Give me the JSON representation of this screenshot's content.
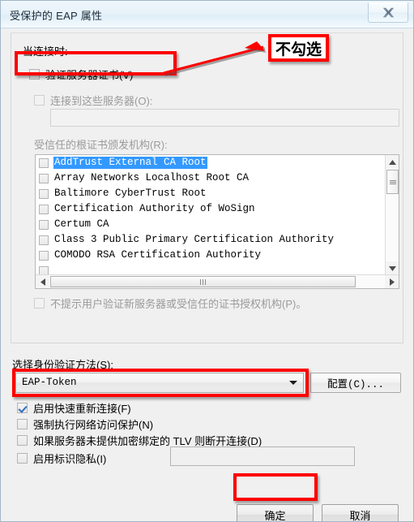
{
  "window": {
    "title": "受保护的 EAP 属性",
    "close_icon": "close-x-icon"
  },
  "group": {
    "when_connecting_label": "当连接时:",
    "validate_server_cert": {
      "label": "验证服务器证书(V)",
      "checked": false
    },
    "connect_to_servers": {
      "label": "连接到这些服务器(O):",
      "checked": false,
      "value": "",
      "disabled": true
    },
    "trusted_roots_label": "受信任的根证书颁发机构(R):",
    "certificates": [
      {
        "name": "AddTrust External CA Root",
        "checked": false,
        "selected": true
      },
      {
        "name": "Array Networks Localhost Root CA",
        "checked": false,
        "selected": false
      },
      {
        "name": "Baltimore CyberTrust Root",
        "checked": false,
        "selected": false
      },
      {
        "name": "Certification Authority of WoSign",
        "checked": false,
        "selected": false
      },
      {
        "name": "Certum CA",
        "checked": false,
        "selected": false
      },
      {
        "name": "Class 3 Public Primary Certification Authority",
        "checked": false,
        "selected": false
      },
      {
        "name": "COMODO RSA Certification Authority",
        "checked": false,
        "selected": false
      },
      {
        "name": "",
        "checked": false,
        "selected": false
      }
    ],
    "no_prompt_user": {
      "label": "不提示用户验证新服务器或受信任的证书授权机构(P)。",
      "checked": false,
      "disabled": true
    }
  },
  "auth": {
    "select_method_label": "选择身份验证方法(S):",
    "method_value": "EAP-Token",
    "configure_button": "配置(C)...",
    "dropdown_icon": "chevron-down-icon"
  },
  "options": [
    {
      "label": "启用快速重新连接(F)",
      "checked": true
    },
    {
      "label": "强制执行网络访问保护(N)",
      "checked": false
    },
    {
      "label": "如果服务器未提供加密绑定的 TLV 则断开连接(D)",
      "checked": false
    },
    {
      "label": "启用标识隐私(I)",
      "checked": false
    }
  ],
  "identity_privacy_input": {
    "value": ""
  },
  "footer": {
    "ok_label": "确定",
    "cancel_label": "取消"
  },
  "annotations": {
    "note_text": "不勾选",
    "highlight_color": "#fe0000"
  },
  "scrollbars": {
    "vertical_up_icon": "triangle-up-icon",
    "vertical_down_icon": "triangle-down-icon",
    "horizontal_left_icon": "triangle-left-icon",
    "horizontal_right_icon": "triangle-right-icon"
  }
}
